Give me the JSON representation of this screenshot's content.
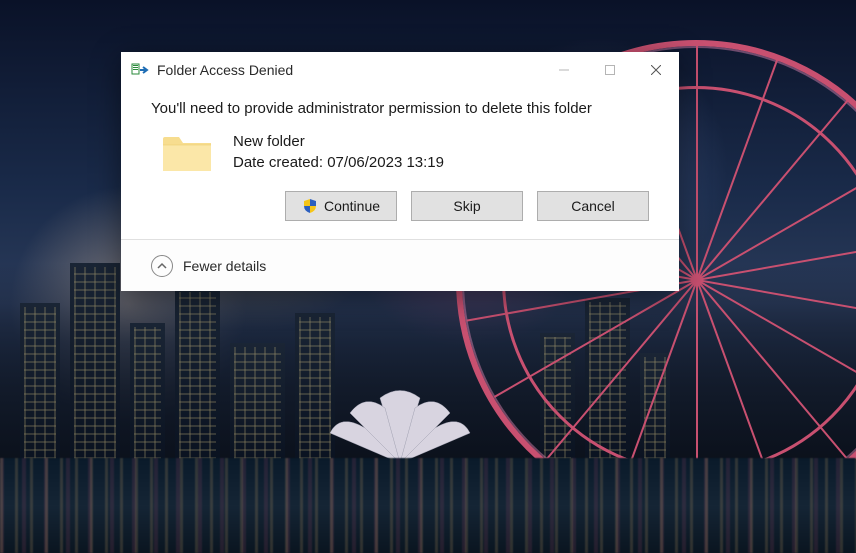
{
  "dialog": {
    "title": "Folder Access Denied",
    "message": "You'll need to provide administrator permission to delete this folder",
    "item": {
      "name": "New folder",
      "meta": "Date created: 07/06/2023 13:19"
    },
    "buttons": {
      "continue": "Continue",
      "skip": "Skip",
      "cancel": "Cancel"
    },
    "footer": {
      "toggle": "Fewer details"
    }
  }
}
